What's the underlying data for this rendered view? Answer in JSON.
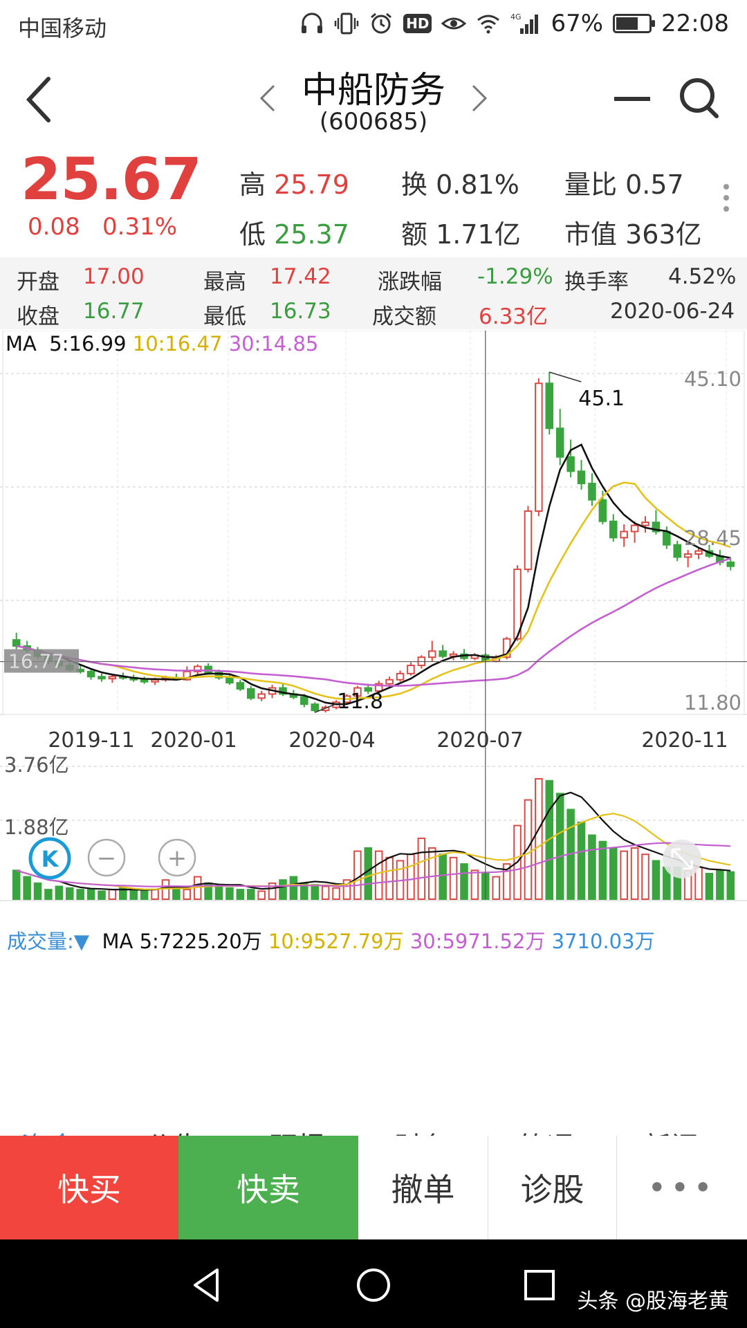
{
  "status_bar": {
    "carrier": "中国移动",
    "network": "4G",
    "battery": "67%",
    "battery_level": 0.67,
    "time": "22:08",
    "icons": [
      "headphones-icon",
      "vibrate-icon",
      "alarm-icon",
      "hd-icon",
      "eye-icon",
      "wifi-icon",
      "signal-icon",
      "battery-icon"
    ]
  },
  "header": {
    "stock_name": "中船防务",
    "stock_code": "(600685)"
  },
  "quote": {
    "price": "25.67",
    "change": "0.08",
    "change_pct": "0.31%",
    "high_label": "高",
    "high": "25.79",
    "low_label": "低",
    "low": "25.37",
    "turnover_label": "换",
    "turnover": "0.81%",
    "amount_label": "额",
    "amount": "1.71亿",
    "vol_ratio_label": "量比",
    "vol_ratio": "0.57",
    "mktcap_label": "市值",
    "mktcap": "363亿"
  },
  "ohlc": {
    "open_label": "开盘",
    "open": "17.00",
    "high_label": "最高",
    "high": "17.42",
    "chg_label": "涨跌幅",
    "chg": "-1.29%",
    "turn_label": "换手率",
    "turn": "4.52%",
    "close_label": "收盘",
    "close": "16.77",
    "low_label": "最低",
    "low": "16.73",
    "amt_label": "成交额",
    "amt": "6.33亿",
    "date": "2020-06-24"
  },
  "chart_data": {
    "type": "candlestick",
    "x_ticks": [
      "2019-11",
      "2020-01",
      "2020-04",
      "2020-07",
      "2020-11"
    ],
    "price_axis": {
      "max_label": "45.10",
      "mid_label": "28.45",
      "min_label": "11.80",
      "cursor_label": "16.77",
      "ylim": [
        11.8,
        45.1
      ]
    },
    "annotations": {
      "high": "45.1",
      "low": "11.8"
    },
    "ma_legend": {
      "label": "MA",
      "ma5": "5:16.99",
      "ma10": "10:16.47",
      "ma30": "30:14.85"
    },
    "colors": {
      "up": "#d94a45",
      "down": "#3aa53f",
      "ma5": "#111111",
      "ma10": "#e5c21b",
      "ma30": "#c35fd0",
      "grid": "#cccccc"
    },
    "candles": [
      [
        18.9,
        19.6,
        18.0,
        18.3
      ],
      [
        18.3,
        18.8,
        17.6,
        17.9
      ],
      [
        17.9,
        18.2,
        17.0,
        17.3
      ],
      [
        17.3,
        17.6,
        16.5,
        16.8
      ],
      [
        16.8,
        17.2,
        16.1,
        16.4
      ],
      [
        16.4,
        16.7,
        15.8,
        16.0
      ],
      [
        16.0,
        16.5,
        15.6,
        15.8
      ],
      [
        15.8,
        16.1,
        15.0,
        15.3
      ],
      [
        15.3,
        15.6,
        14.8,
        15.1
      ],
      [
        15.1,
        15.5,
        14.7,
        15.3
      ],
      [
        15.3,
        15.7,
        15.0,
        15.2
      ],
      [
        15.2,
        15.5,
        14.8,
        15.0
      ],
      [
        15.0,
        15.3,
        14.6,
        14.8
      ],
      [
        14.8,
        15.2,
        14.5,
        15.0
      ],
      [
        15.0,
        15.4,
        14.8,
        15.2
      ],
      [
        15.2,
        15.6,
        14.9,
        15.0
      ],
      [
        15.0,
        16.3,
        14.9,
        15.8
      ],
      [
        15.8,
        16.5,
        15.5,
        16.3
      ],
      [
        16.3,
        16.6,
        15.5,
        15.7
      ],
      [
        15.7,
        16.0,
        15.0,
        15.2
      ],
      [
        15.2,
        15.5,
        14.5,
        14.7
      ],
      [
        14.7,
        15.0,
        13.9,
        14.1
      ],
      [
        14.1,
        14.4,
        13.0,
        13.2
      ],
      [
        13.2,
        13.9,
        12.9,
        13.6
      ],
      [
        13.6,
        14.5,
        13.2,
        14.2
      ],
      [
        14.2,
        14.6,
        13.4,
        13.6
      ],
      [
        13.6,
        14.0,
        13.1,
        13.3
      ],
      [
        13.3,
        13.6,
        12.3,
        12.6
      ],
      [
        12.6,
        12.8,
        11.8,
        12.0
      ],
      [
        12.0,
        12.5,
        11.8,
        12.3
      ],
      [
        12.3,
        13.0,
        12.1,
        12.8
      ],
      [
        12.8,
        13.6,
        12.6,
        13.4
      ],
      [
        13.4,
        14.4,
        13.2,
        14.2
      ],
      [
        14.2,
        14.6,
        13.6,
        13.9
      ],
      [
        13.9,
        14.9,
        13.8,
        14.6
      ],
      [
        14.6,
        15.3,
        14.3,
        15.0
      ],
      [
        15.0,
        15.9,
        14.8,
        15.6
      ],
      [
        15.6,
        16.7,
        15.4,
        16.4
      ],
      [
        16.4,
        17.4,
        16.1,
        17.2
      ],
      [
        17.2,
        18.8,
        16.8,
        17.8
      ],
      [
        17.8,
        18.4,
        17.1,
        17.3
      ],
      [
        17.3,
        17.8,
        16.9,
        17.5
      ],
      [
        17.5,
        18.0,
        16.9,
        17.1
      ],
      [
        17.1,
        17.6,
        16.9,
        17.4
      ],
      [
        17.4,
        17.6,
        16.7,
        16.8
      ],
      [
        16.8,
        17.4,
        16.7,
        17.2
      ],
      [
        17.2,
        19.2,
        17.0,
        19.0
      ],
      [
        19.0,
        26.2,
        18.8,
        25.8
      ],
      [
        25.8,
        32.0,
        25.5,
        31.5
      ],
      [
        31.5,
        44.5,
        31.0,
        44.0
      ],
      [
        44.0,
        45.1,
        39.0,
        39.6
      ],
      [
        39.6,
        41.5,
        36.0,
        36.8
      ],
      [
        36.8,
        38.5,
        34.8,
        35.4
      ],
      [
        35.4,
        36.5,
        33.6,
        34.2
      ],
      [
        34.2,
        35.2,
        32.0,
        32.6
      ],
      [
        32.6,
        33.5,
        30.2,
        30.5
      ],
      [
        30.5,
        31.2,
        28.5,
        28.9
      ],
      [
        28.9,
        30.2,
        28.0,
        29.5
      ],
      [
        29.5,
        30.5,
        28.4,
        30.1
      ],
      [
        30.1,
        31.0,
        29.4,
        30.4
      ],
      [
        30.4,
        31.6,
        29.2,
        29.5
      ],
      [
        29.5,
        30.0,
        27.8,
        28.2
      ],
      [
        28.2,
        28.6,
        26.6,
        27.0
      ],
      [
        27.0,
        27.7,
        26.0,
        27.3
      ],
      [
        27.3,
        28.0,
        26.8,
        27.6
      ],
      [
        27.6,
        28.2,
        26.9,
        27.1
      ],
      [
        27.1,
        27.7,
        26.2,
        26.5
      ],
      [
        26.5,
        26.9,
        25.7,
        26.1
      ]
    ],
    "volume": {
      "legend_label": "成交量:",
      "ma5": "MA 5:7225.20万",
      "ma10": "10:9527.79万",
      "ma30": "30:5971.52万",
      "current": "3710.03万",
      "axis_top": "3.76亿",
      "axis_mid": "1.88亿",
      "max": 3.76,
      "values": [
        0.9,
        0.7,
        0.5,
        0.3,
        0.4,
        0.35,
        0.3,
        0.3,
        0.25,
        0.3,
        0.35,
        0.3,
        0.25,
        0.3,
        0.6,
        0.4,
        0.3,
        0.7,
        0.5,
        0.4,
        0.35,
        0.3,
        0.3,
        0.25,
        0.5,
        0.6,
        0.7,
        0.5,
        0.45,
        0.4,
        0.35,
        0.6,
        1.5,
        1.6,
        1.5,
        1.3,
        1.2,
        1.4,
        1.9,
        1.6,
        1.4,
        1.3,
        1.1,
        0.9,
        0.8,
        0.7,
        1.1,
        2.3,
        3.1,
        3.76,
        3.7,
        3.3,
        2.8,
        2.4,
        2.0,
        1.8,
        1.6,
        1.5,
        1.6,
        1.4,
        1.2,
        1.0,
        1.0,
        0.9,
        1.0,
        0.8,
        0.9,
        0.85
      ]
    }
  },
  "zoom_controls": {
    "k_label": "K",
    "minus": "−",
    "plus": "+"
  },
  "tabs": [
    "资金",
    "公告",
    "研报",
    "财务",
    "简况",
    "新闻"
  ],
  "actions": {
    "buy": "快买",
    "sell": "快卖",
    "cancel": "撤单",
    "diagnose": "诊股",
    "more": "•••"
  },
  "watermark": "头条 @股海老黄"
}
